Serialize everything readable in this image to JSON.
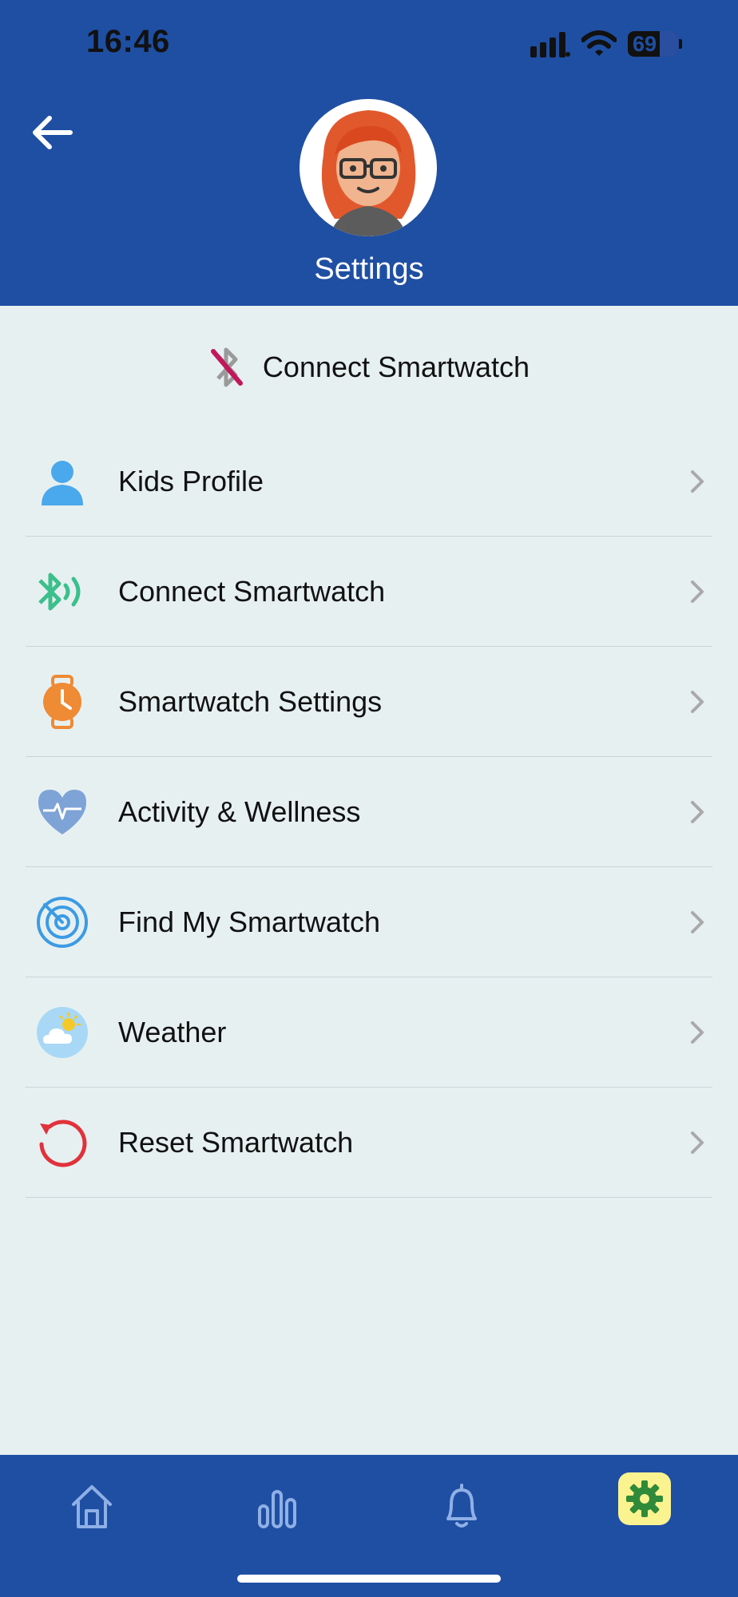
{
  "status_bar": {
    "time": "16:46",
    "battery_level": "69"
  },
  "header": {
    "title": "Settings"
  },
  "connect_banner": {
    "label": "Connect Smartwatch"
  },
  "menu": {
    "items": [
      {
        "label": "Kids Profile",
        "icon": "person-icon"
      },
      {
        "label": "Connect Smartwatch",
        "icon": "bluetooth-signal-icon"
      },
      {
        "label": "Smartwatch Settings",
        "icon": "watch-icon"
      },
      {
        "label": "Activity & Wellness",
        "icon": "heart-pulse-icon"
      },
      {
        "label": "Find My Smartwatch",
        "icon": "radar-icon"
      },
      {
        "label": "Weather",
        "icon": "weather-icon"
      },
      {
        "label": "Reset Smartwatch",
        "icon": "reset-icon"
      }
    ]
  },
  "tabbar": {
    "tabs": [
      {
        "name": "home",
        "icon": "home-icon"
      },
      {
        "name": "stats",
        "icon": "bar-chart-icon"
      },
      {
        "name": "notifications",
        "icon": "bell-icon"
      },
      {
        "name": "settings",
        "icon": "gear-icon",
        "active": true
      }
    ]
  },
  "colors": {
    "primary": "#1f4fa3",
    "background": "#e7f0f1",
    "active_tab_bg": "#fbf38f",
    "active_tab_icon": "#2f8a3a"
  }
}
